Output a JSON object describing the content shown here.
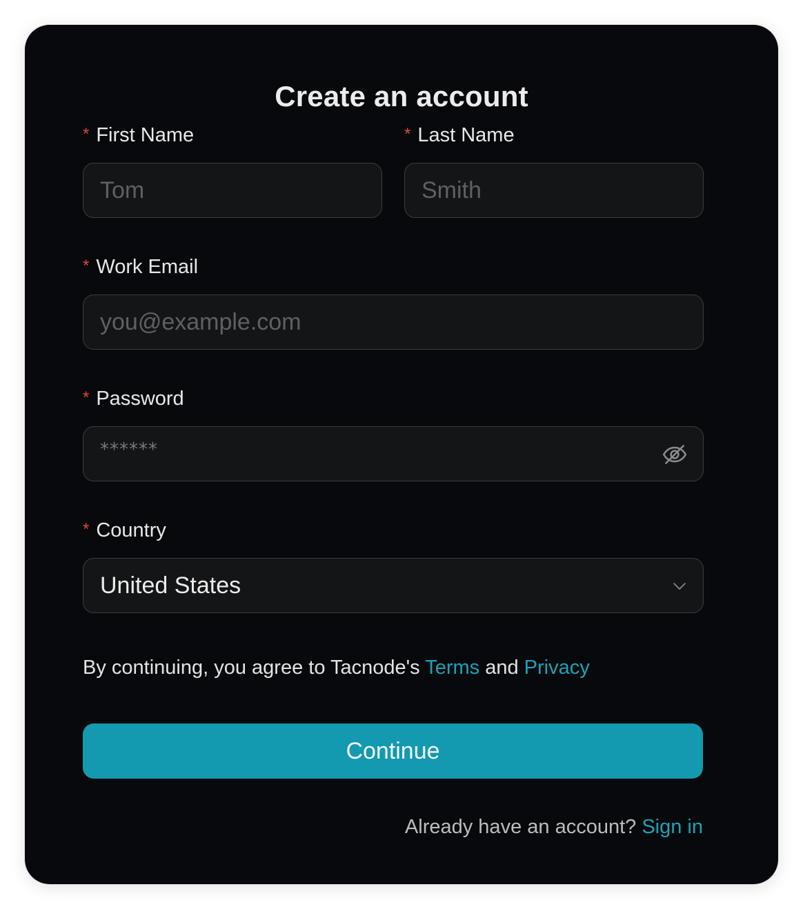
{
  "form": {
    "title": "Create an account",
    "required_mark": "*",
    "first_name": {
      "label": "First Name",
      "placeholder": "Tom",
      "value": ""
    },
    "last_name": {
      "label": "Last Name",
      "placeholder": "Smith",
      "value": ""
    },
    "email": {
      "label": "Work Email",
      "placeholder": "you@example.com",
      "value": ""
    },
    "password": {
      "label": "Password",
      "masked_placeholder": "******",
      "toggle_icon": "eye-off-icon"
    },
    "country": {
      "label": "Country",
      "selected": "United States",
      "dropdown_icon": "chevron-down-icon"
    },
    "agreement": {
      "prefix": "By continuing, you agree to Tacnode's ",
      "terms_link": "Terms",
      "conjunction": " and ",
      "privacy_link": "Privacy"
    },
    "submit_label": "Continue",
    "signin": {
      "prompt": "Already have an account? ",
      "link": "Sign in"
    }
  },
  "colors": {
    "card_background": "#07090c",
    "field_background": "#141517",
    "field_border": "#3b3d41",
    "accent": "#1399b0",
    "link": "#1ba3b7",
    "required": "#e0463a"
  }
}
